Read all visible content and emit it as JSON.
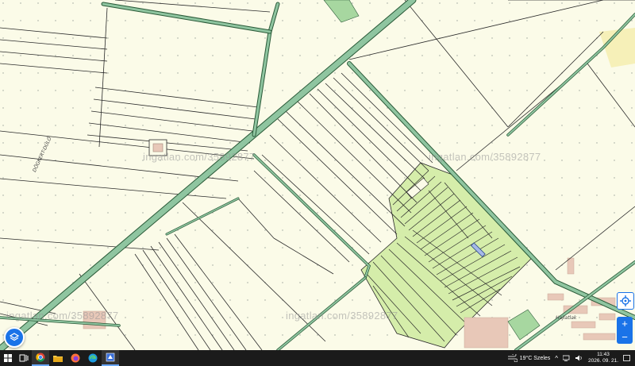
{
  "map": {
    "watermarks": [
      "ingatlan.com/35892877",
      "ingatlan.com/35892877",
      "ingatlan.com/35892877",
      "ingatlan.com/35892877"
    ],
    "street_labels": {
      "dogkert": "DÖGKERT-DŰLŐ",
      "ullo": "Hajlatlak"
    },
    "colors": {
      "background": "#fbfbe8",
      "road": "#8fc5a0",
      "road_edge": "#2a5a38",
      "lines": "#2a2a2a",
      "highlight_parcels": "#d5edaa",
      "building": "#e8c8b8",
      "green_area": "#a7d7a0"
    }
  },
  "controls": {
    "layers_icon": "layers-icon",
    "locate_icon": "crosshair-icon",
    "zoom_in": "+",
    "zoom_out": "−"
  },
  "taskbar": {
    "icons": [
      "start-icon",
      "chrome-icon",
      "file-explorer-icon",
      "firefox-icon",
      "edge-icon",
      "app-icon"
    ],
    "weather": "19°C Szeles",
    "time": "11:43",
    "date": "2026. 09. 21."
  }
}
